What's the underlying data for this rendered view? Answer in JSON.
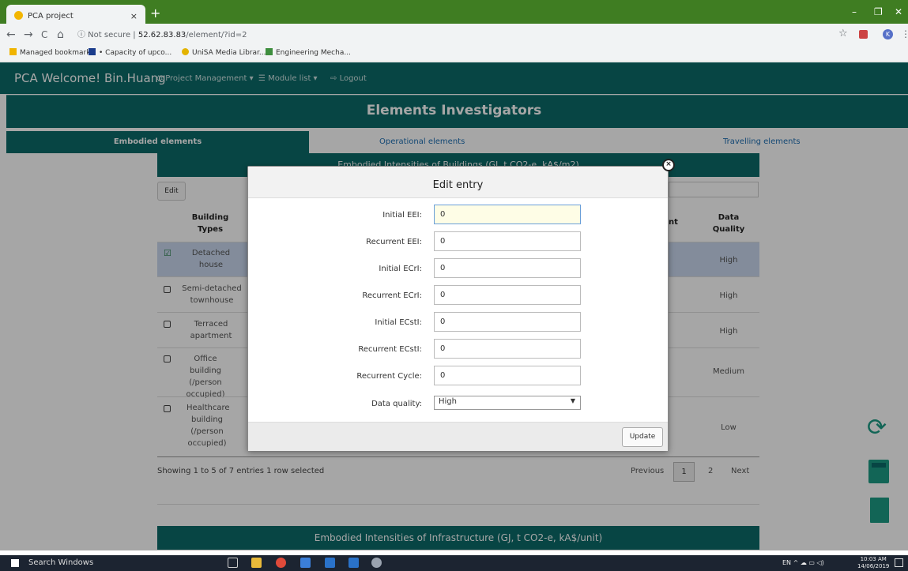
{
  "browser": {
    "tab_title": "PCA project",
    "tab_close": "×",
    "new_tab": "+",
    "nav_back": "←",
    "nav_forward": "→",
    "nav_reload": "C",
    "nav_home": "⌂",
    "security_label": "ⓘ Not secure",
    "url_host": "52.62.83.83",
    "url_path": "/element/?id=2",
    "profile_initial": "K",
    "bookmarks": [
      {
        "label": "Managed bookmarks",
        "color": "#f0b400"
      },
      {
        "label": "• Capacity of upco...",
        "color": "#1a3c8c"
      },
      {
        "label": "UniSA Media Librar...",
        "color": "#e3b300"
      },
      {
        "label": "Engineering Mecha...",
        "color": "#3e8e3e"
      }
    ],
    "window_controls": [
      "–",
      "❐",
      "✕"
    ]
  },
  "navbar": {
    "brand": "PCA  Welcome! Bin.Huang",
    "menu_project": "Project Management ▾",
    "menu_module": "☰ Module list ▾",
    "menu_logout": "Logout"
  },
  "page": {
    "title": "Elements Investigators",
    "tabs": [
      "Embodied elements",
      "Operational elements",
      "Travelling elements"
    ],
    "panel_title": "Embodied Intensities of Buildings (GJ, t CO2-e, kA$/m2)",
    "edit_label": "Edit",
    "columns": {
      "building_types": "Building Types",
      "partial_col": "nt",
      "data_quality": "Data Quality"
    },
    "rows": [
      {
        "type": "Detached house",
        "quality": "High",
        "selected": true
      },
      {
        "type": "Semi-detached townhouse",
        "quality": "High",
        "selected": false
      },
      {
        "type": "Terraced apartment",
        "quality": "High",
        "selected": false
      },
      {
        "type": "Office building (/person occupied)",
        "quality": "Medium",
        "selected": false
      },
      {
        "type": "Healthcare building (/person occupied)",
        "quality": "Low",
        "selected": false
      }
    ],
    "footer_info": "Showing 1 to 5 of 7 entries   1 row selected",
    "pagination": {
      "previous": "Previous",
      "page1": "1",
      "page2": "2",
      "next": "Next"
    },
    "panel2_title": "Embodied Intensities of Infrastructure (GJ, t CO2-e, kA$/unit)"
  },
  "modal": {
    "title": "Edit entry",
    "close": "×",
    "fields": [
      {
        "label": "Initial EEI:",
        "value": "0"
      },
      {
        "label": "Recurrent EEI:",
        "value": "0"
      },
      {
        "label": "Initial ECrI:",
        "value": "0"
      },
      {
        "label": "Recurrent ECrI:",
        "value": "0"
      },
      {
        "label": "Initial ECstI:",
        "value": "0"
      },
      {
        "label": "Recurrent ECstI:",
        "value": "0"
      },
      {
        "label": "Recurrent Cycle:",
        "value": "0"
      }
    ],
    "quality_label": "Data quality:",
    "quality_value": "High",
    "update_button": "Update"
  },
  "sidebar_icons": [
    "refresh-icon",
    "calculator-icon",
    "export-icon"
  ],
  "taskbar": {
    "search": "Search Windows",
    "lang": "EN",
    "time": "10:03 AM",
    "date": "14/06/2019"
  },
  "colors": {
    "primary": "#0c6b69",
    "accent": "#1d9b84",
    "chrome": "#3f7d22"
  }
}
